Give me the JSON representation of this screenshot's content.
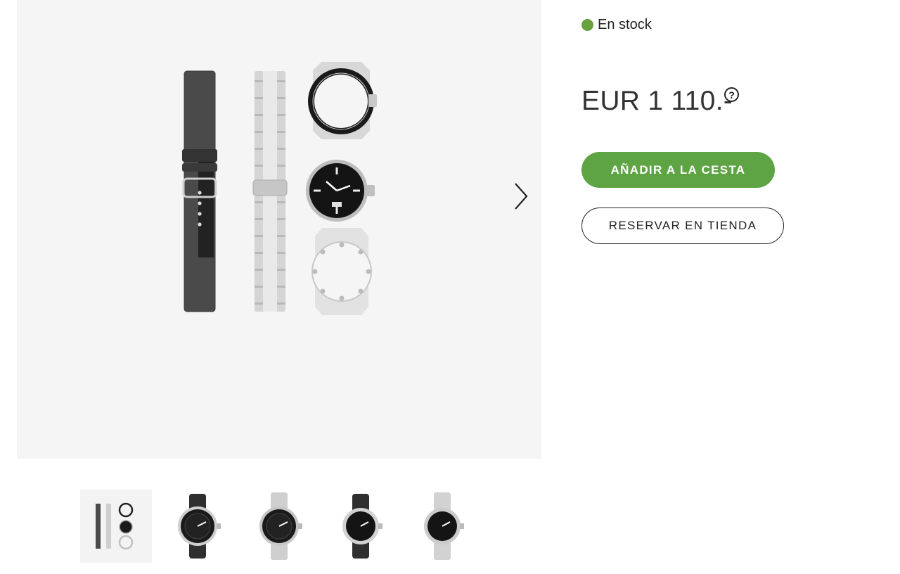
{
  "product": {
    "stock_status": "En stock",
    "stock_color": "#67a23e",
    "price": "EUR 1 110.-",
    "price_help_icon": "question-circle-icon",
    "add_to_cart_label": "AÑADIR A LA CESTA",
    "reserve_label": "RESERVAR EN TIENDA",
    "brand_color": "#5ea444"
  },
  "gallery": {
    "main_image": "watch-kit-components",
    "next_icon": "chevron-right-icon",
    "thumbnails": [
      {
        "name": "watch-kit-components",
        "active": true
      },
      {
        "name": "watch-black-strap-bezel",
        "active": false
      },
      {
        "name": "watch-steel-bracelet-bezel",
        "active": false
      },
      {
        "name": "watch-black-strap-plain",
        "active": false
      },
      {
        "name": "watch-steel-bracelet-plain",
        "active": false
      }
    ]
  }
}
